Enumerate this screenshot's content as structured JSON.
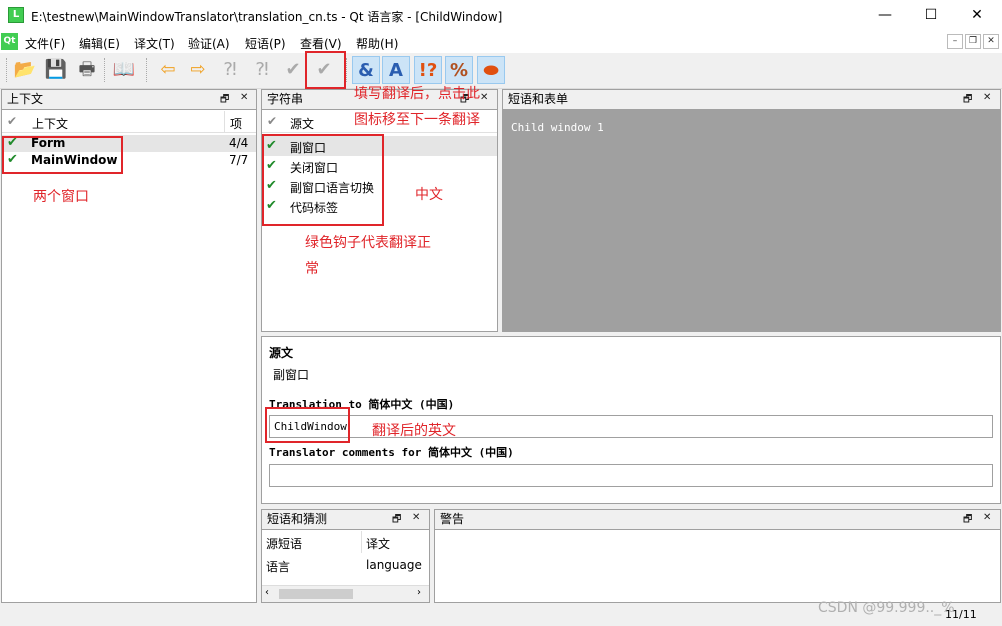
{
  "window": {
    "title": "E:\\testnew\\MainWindowTranslator\\translation_cn.ts - Qt 语言家 - [ChildWindow]",
    "app_icon": "L",
    "minimize": "—",
    "maximize": "☐",
    "close": "✕"
  },
  "menubar": {
    "logo": "Qt",
    "items": [
      "文件(F)",
      "编辑(E)",
      "译文(T)",
      "验证(A)",
      "短语(P)",
      "查看(V)",
      "帮助(H)"
    ]
  },
  "toolbar": {
    "icons": [
      "open-icon",
      "save-icon",
      "print-icon",
      "phrasebook-icon",
      "prev-icon",
      "next-icon",
      "prev-unfinished-icon",
      "next-unfinished-icon",
      "done-icon",
      "done-and-next-icon",
      "accelerator-check-icon",
      "punctuation-check-icon",
      "phrase-check-icon",
      "placemarker-check-icon",
      "surroundings-icon"
    ]
  },
  "context_dock": {
    "title": "上下文",
    "col_context": "上下文",
    "col_items": "项",
    "rows": [
      {
        "name": "Form",
        "count": "4/4"
      },
      {
        "name": "MainWindow",
        "count": "7/7"
      }
    ]
  },
  "strings_dock": {
    "title": "字符串",
    "col_source": "源文",
    "rows": [
      "副窗口",
      "关闭窗口",
      "副窗口语言切换",
      "代码标签"
    ]
  },
  "forms_dock": {
    "title": "短语和表单",
    "preview_text": "Child window 1"
  },
  "editor": {
    "source_label": "源文",
    "source_text": "副窗口",
    "translation_label": "Translation to 简体中文 (中国)",
    "translation_value": "ChildWindow",
    "comments_label": "Translator comments for 简体中文 (中国)",
    "comments_value": ""
  },
  "phrases_dock": {
    "title": "短语和猜测",
    "col_source": "源短语",
    "col_translation": "译文",
    "rows": [
      {
        "source": "语言",
        "translation": "language"
      }
    ]
  },
  "warnings_dock": {
    "title": "警告"
  },
  "statusbar": {
    "progress": "11/11"
  },
  "annotations": {
    "two_windows": "两个窗口",
    "fill_translation": "填写翻译后，点击此",
    "move_next": "图标移至下一条翻译",
    "chinese": "中文",
    "green_check_1": "绿色钩子代表翻译正",
    "green_check_2": "常",
    "translated_english": "翻译后的英文"
  },
  "watermark": "CSDN @99.999.._%",
  "colors": {
    "annotation_red": "#e0252a",
    "check_green": "#1f8a2a",
    "preview_gray": "#a0a0a0"
  }
}
